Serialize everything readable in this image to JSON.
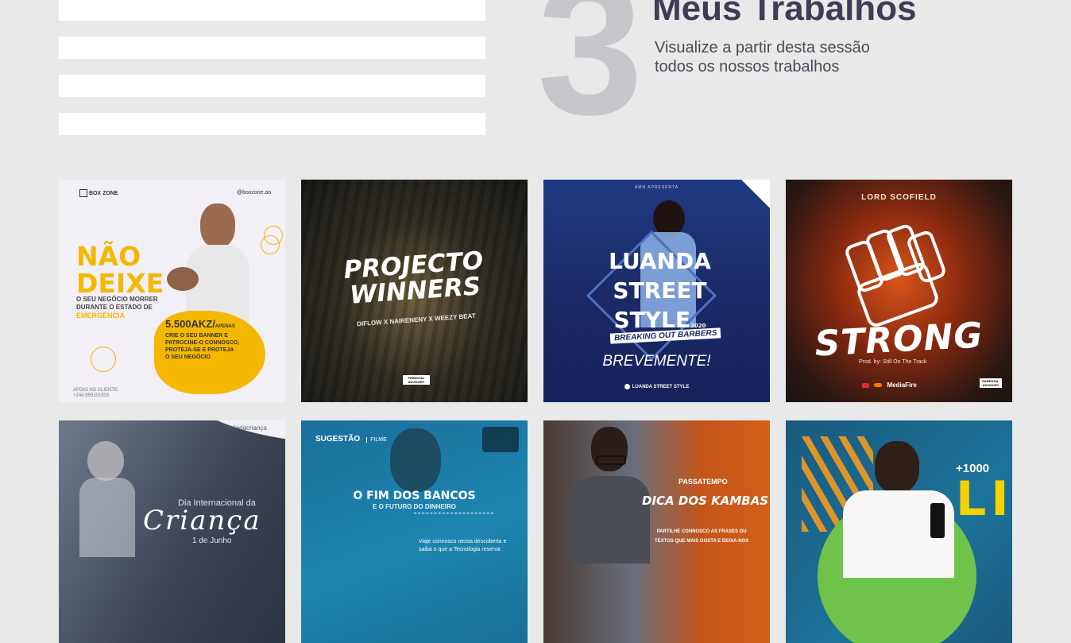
{
  "section": {
    "number": "3",
    "title": "Meus Trabalhos",
    "subtitle_line1": "Visualize a partir desta sessão",
    "subtitle_line2": "todos os nossos trabalhos"
  },
  "works": [
    {
      "brand": "BOX ZONE",
      "handle": "@boxzone.ao",
      "headline1": "NÃO",
      "headline2": "DEIXE",
      "tagline1": "O SEU NEGÓCIO MORRER",
      "tagline2": "DURANTE O ESTADO DE",
      "tagline3": "EMERGÊNCIA",
      "price": "5.500AKZ/",
      "price_suffix": "APENAS",
      "offer1": "CRIE O SEU BANNER E",
      "offer2": "PATROCINE-O CONNOSCO,",
      "offer3": "PROTEJA-SE E PROTEJA",
      "offer4": "O SEU NEGÓCIO",
      "contact1": "APOIO AO CLIENTE:",
      "contact2": "+244 959101503"
    },
    {
      "title1": "PROJECTO",
      "title2": "WINNERS",
      "credits": "DIFLOW  X  NAIRENENY  X  WEEZY BEAT",
      "advisory": "PARENTAL ADVISORY"
    },
    {
      "presenter": "AMN APRESENTA",
      "title1": "LUANDA",
      "title2": "STREET",
      "title3": "STYLE",
      "year": "2020",
      "subtitle": "BREAKING OUT BARBERS",
      "cta": "BREVEMENTE!",
      "page": "LUANDA STREET STYLE"
    },
    {
      "artist": "LORD SCOFIELD",
      "title": "STRONG",
      "producer": "Prod. by: Still On The Track",
      "service": "MediaFire",
      "advisory": "PARENTAL ADVISORY"
    },
    {
      "hashtag": "#diadacriança",
      "line1": "Dia Internacional da",
      "line2": "Criança",
      "line3": "1 de Junho"
    },
    {
      "badge": "SUGESTÃO",
      "badge_suffix": "FILME",
      "title1": "O FIM DOS BANCOS",
      "title2": "E O FUTURO DO DINHEIRO",
      "body1": "Viaje connosco nessa descoberta e",
      "body2": "saiba o que a Tecnologia reserva"
    },
    {
      "kicker": "PASSATEMPO",
      "title": "DICA DOS KAMBAS",
      "body1": "PARTILHE CONNOSCO AS FRASES OU",
      "body2": "TEXTOS QUE MAIS GOSTA E DEIXA-NOS"
    },
    {
      "count": "+1000",
      "word": "LI"
    }
  ],
  "colors": {
    "background": "#e9e9e9",
    "big_number": "#c6c6cb",
    "title": "#3e3d55",
    "accent_yellow": "#f5b800"
  }
}
